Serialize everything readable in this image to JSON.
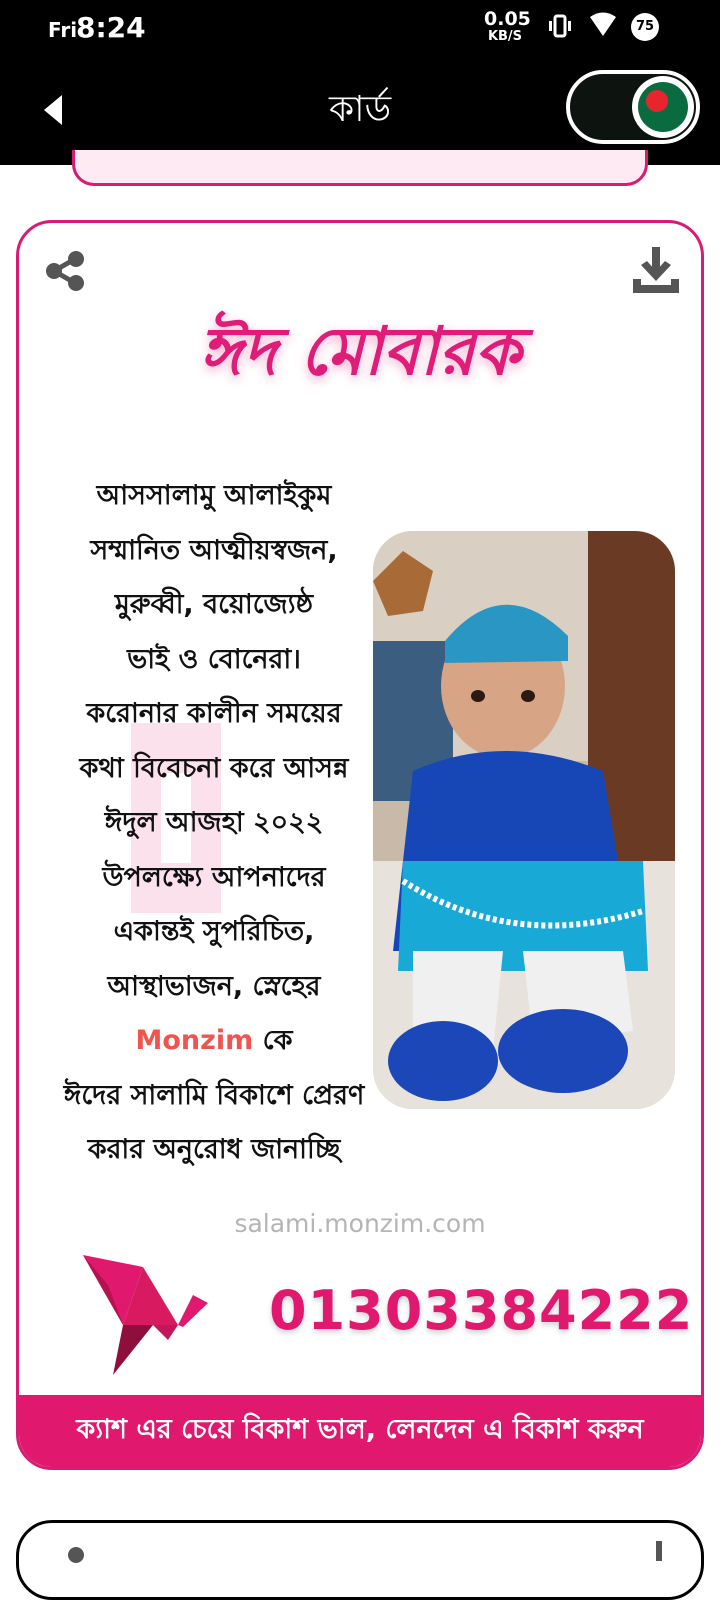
{
  "status_bar": {
    "day": "Fri",
    "time": "8:24",
    "net_speed": "0.05",
    "net_unit": "KB/S",
    "battery": "75"
  },
  "app_bar": {
    "title": "কার্ড",
    "flag_colors": {
      "green": "#0b6b40",
      "red": "#e8252f"
    }
  },
  "card": {
    "heading": "ঈদ মোবারক",
    "message_lines": [
      "আসসালামু আলাইকুম",
      "সম্মানিত আত্মীয়স্বজন,",
      "মুরুব্বী, বয়োজ্যেষ্ঠ",
      "ভাই ও বোনেরা।",
      "করোনার কালীন সময়ের",
      "কথা বিবেচনা করে আসন্ন",
      "ঈদুল আজহা ২০২২",
      "উপলক্ষ্যে আপনাদের",
      "একান্তই সুপরিচিত,",
      "আস্থাভাজন, স্নেহের"
    ],
    "name": "Monzim",
    "name_suffix": " কে",
    "message_end_lines": [
      "ঈদের সালামি বিকাশে প্রেরণ",
      "করার অনুরোধ জানাচ্ছি"
    ],
    "website": "salami.monzim.com",
    "phone": "01303384222",
    "footer_text": "ক্যাশ এর চেয়ে বিকাশ ভাল, লেনদেন এ বিকাশ করুন",
    "accent_color": "#e0196f"
  }
}
